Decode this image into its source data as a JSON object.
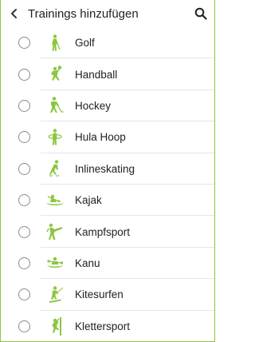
{
  "header": {
    "title": "Trainings hinzufügen",
    "back_icon": "back-arrow-icon",
    "search_icon": "search-icon"
  },
  "colors": {
    "accent": "#8cc63f",
    "radio_border": "#8a8a8a",
    "divider": "#e6e6e6"
  },
  "sports": [
    {
      "label": "Golf",
      "icon": "golf-icon"
    },
    {
      "label": "Handball",
      "icon": "handball-icon"
    },
    {
      "label": "Hockey",
      "icon": "hockey-icon"
    },
    {
      "label": "Hula Hoop",
      "icon": "hula-hoop-icon"
    },
    {
      "label": "Inlineskating",
      "icon": "inline-skating-icon"
    },
    {
      "label": "Kajak",
      "icon": "kayak-icon"
    },
    {
      "label": "Kampfsport",
      "icon": "martial-arts-icon"
    },
    {
      "label": "Kanu",
      "icon": "canoe-icon"
    },
    {
      "label": "Kitesurfen",
      "icon": "kitesurfing-icon"
    },
    {
      "label": "Klettersport",
      "icon": "climbing-icon"
    }
  ]
}
